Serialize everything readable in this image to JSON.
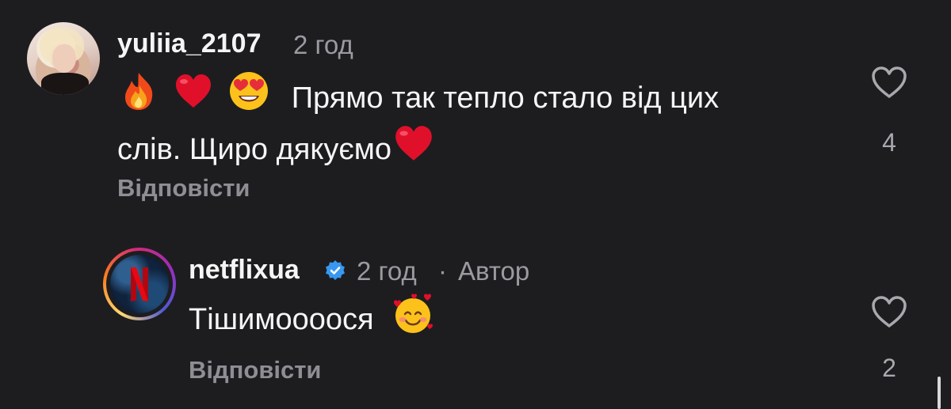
{
  "comments": [
    {
      "username": "yuliia_2107",
      "time": "2 год",
      "text_line1": "Прямо так тепло стало від цих",
      "text_line2": "слів. Щиро дякуємо",
      "emojis": [
        "fire-emoji",
        "red-heart-emoji",
        "heart-eyes-emoji",
        "red-heart-emoji"
      ],
      "reply_label": "Відповісти",
      "like_count": "4"
    },
    {
      "username": "netflixua",
      "verified": true,
      "time": "2 год",
      "separator": "·",
      "author_label": "Автор",
      "text": "Тішимоооося",
      "emojis": [
        "smiling-face-with-hearts-emoji"
      ],
      "reply_label": "Відповісти",
      "like_count": "2"
    }
  ],
  "colors": {
    "background": "#1d1d20",
    "primary_text": "#f5f5f5",
    "secondary_text": "#9a9aa0",
    "verified_blue": "#3897f0",
    "heart_red": "#e0102b"
  },
  "icons": {
    "like": "heart-outline-icon",
    "verified": "verified-badge-icon"
  }
}
